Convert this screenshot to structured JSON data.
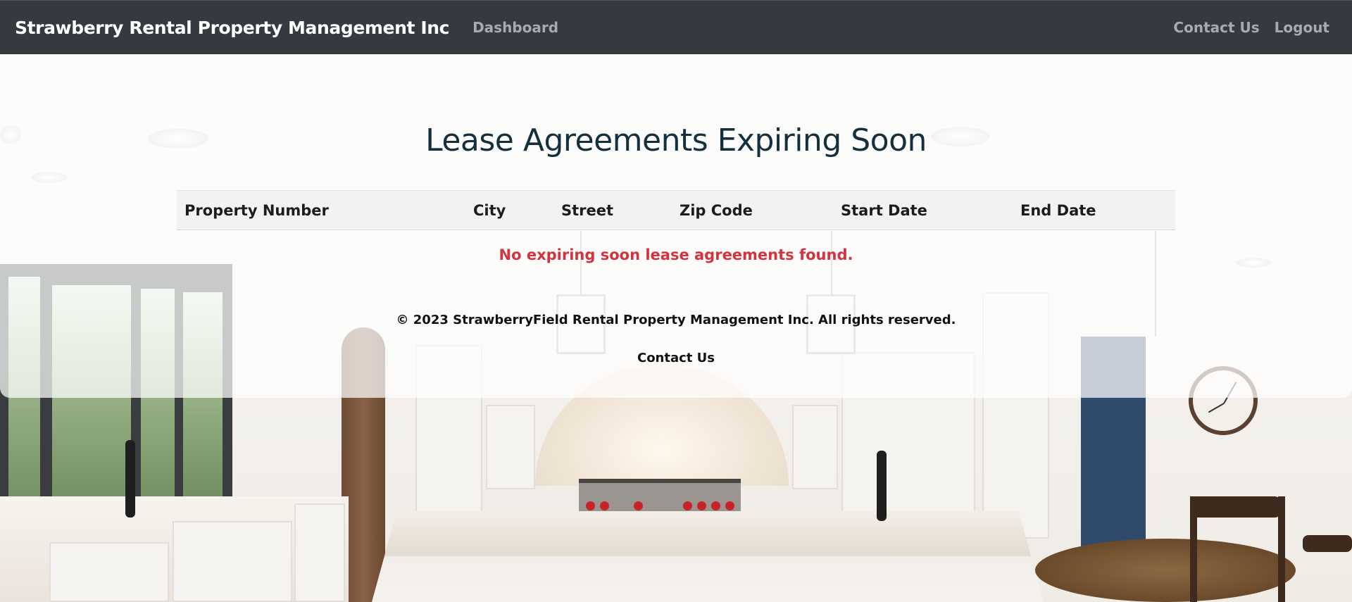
{
  "navbar": {
    "brand": "Strawberry Rental Property Management Inc",
    "dashboard_label": "Dashboard",
    "contact_label": "Contact Us",
    "logout_label": "Logout"
  },
  "main": {
    "title": "Lease Agreements Expiring Soon",
    "table": {
      "columns": [
        "Property Number",
        "City",
        "Street",
        "Zip Code",
        "Start Date",
        "End Date"
      ],
      "rows": []
    },
    "empty_message": "No expiring soon lease agreements found."
  },
  "footer": {
    "copyright": "© 2023 StrawberryField Rental Property Management Inc. All rights reserved.",
    "contact_label": "Contact Us"
  },
  "colors": {
    "navbar_bg": "#343a40",
    "brand_text": "#ffffff",
    "nav_link": "#a7abaf",
    "title_text": "#142f3d",
    "error_text": "#d33340",
    "header_bg": "#f2f2f2"
  },
  "background": "kitchen-photo"
}
